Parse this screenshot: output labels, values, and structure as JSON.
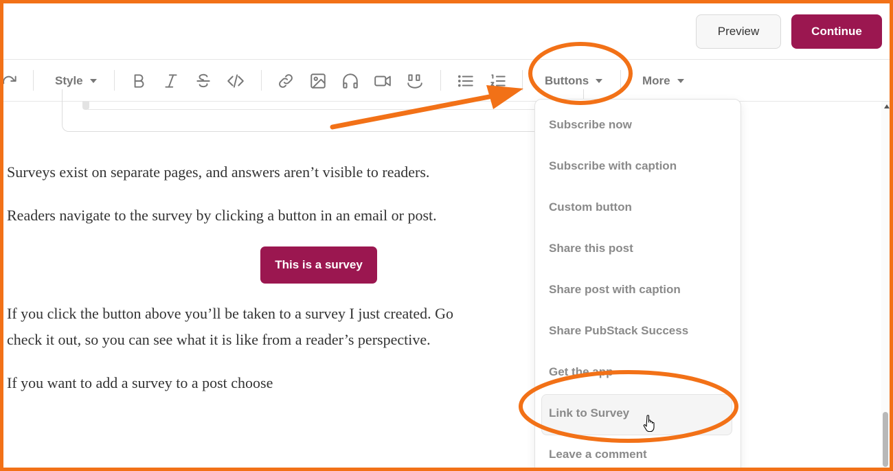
{
  "header": {
    "preview_label": "Preview",
    "continue_label": "Continue"
  },
  "toolbar": {
    "style_label": "Style",
    "buttons_label": "Buttons",
    "more_label": "More",
    "icons": [
      "redo-icon",
      "bold-icon",
      "italic-icon",
      "strikethrough-icon",
      "code-icon",
      "link-icon",
      "image-icon",
      "audio-icon",
      "video-icon",
      "quote-icon",
      "bullet-list-icon",
      "numbered-list-icon"
    ]
  },
  "content": {
    "para1": "Surveys exist on separate pages, and answers aren’t visible to readers.",
    "para2": "Readers navigate to the survey by clicking a button in an email or post.",
    "survey_button": "This is a survey",
    "para3_line1": "If you click the button above you’ll be taken to a survey I just created.  Go",
    "para3_line2": "check it out, so you can see what it is like from a reader’s perspective.",
    "para4": "If you want to add a survey to a post choose"
  },
  "buttons_menu": {
    "items": [
      "Subscribe now",
      "Subscribe with caption",
      "Custom button",
      "Share this post",
      "Share post with caption",
      "Share PubStack Success",
      "Get the app",
      "Link to Survey",
      "Leave a comment"
    ],
    "hovered": "Link to Survey"
  },
  "colors": {
    "accent": "#9b1750",
    "annotation": "#f27117"
  }
}
